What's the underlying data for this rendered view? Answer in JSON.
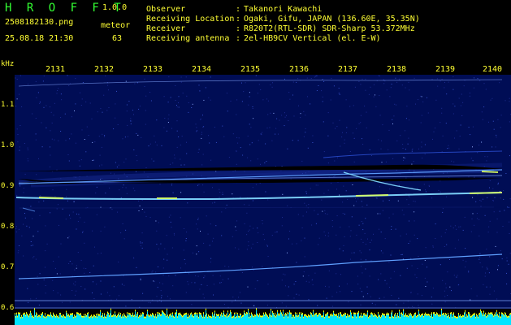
{
  "app": {
    "name": "H R O F F T",
    "version": "1.0.0"
  },
  "capture": {
    "filename": "2508182130.png",
    "type_label": "meteor",
    "datetime": "25.08.18 21:30",
    "count": "63"
  },
  "info": [
    {
      "label": "Observer",
      "value": "Takanori Kawachi"
    },
    {
      "label": "Receiving Location",
      "value": "Ogaki, Gifu, JAPAN (136.60E, 35.35N)"
    },
    {
      "label": "Receiver",
      "value": "R820T2(RTL-SDR) SDR-Sharp 53.372MHz"
    },
    {
      "label": "Receiving antenna",
      "value": "2el-HB9CV Vertical (el. E-W)"
    }
  ],
  "spectrogram": {
    "freq_unit": "kHz",
    "freq_ticks": [
      "1.1",
      "1.0",
      "0.9",
      "0.8",
      "0.7",
      "0.6"
    ],
    "time_ticks": [
      "2131",
      "2132",
      "2133",
      "2134",
      "2135",
      "2136",
      "2137",
      "2138",
      "2139",
      "2140"
    ],
    "colors": {
      "axis": "#ffff33",
      "background": "#000d55",
      "trace": "#7fd8ff",
      "bright_trace": "#d8ff60",
      "meter": "#00e5ff",
      "peak": "#ffff00"
    }
  }
}
